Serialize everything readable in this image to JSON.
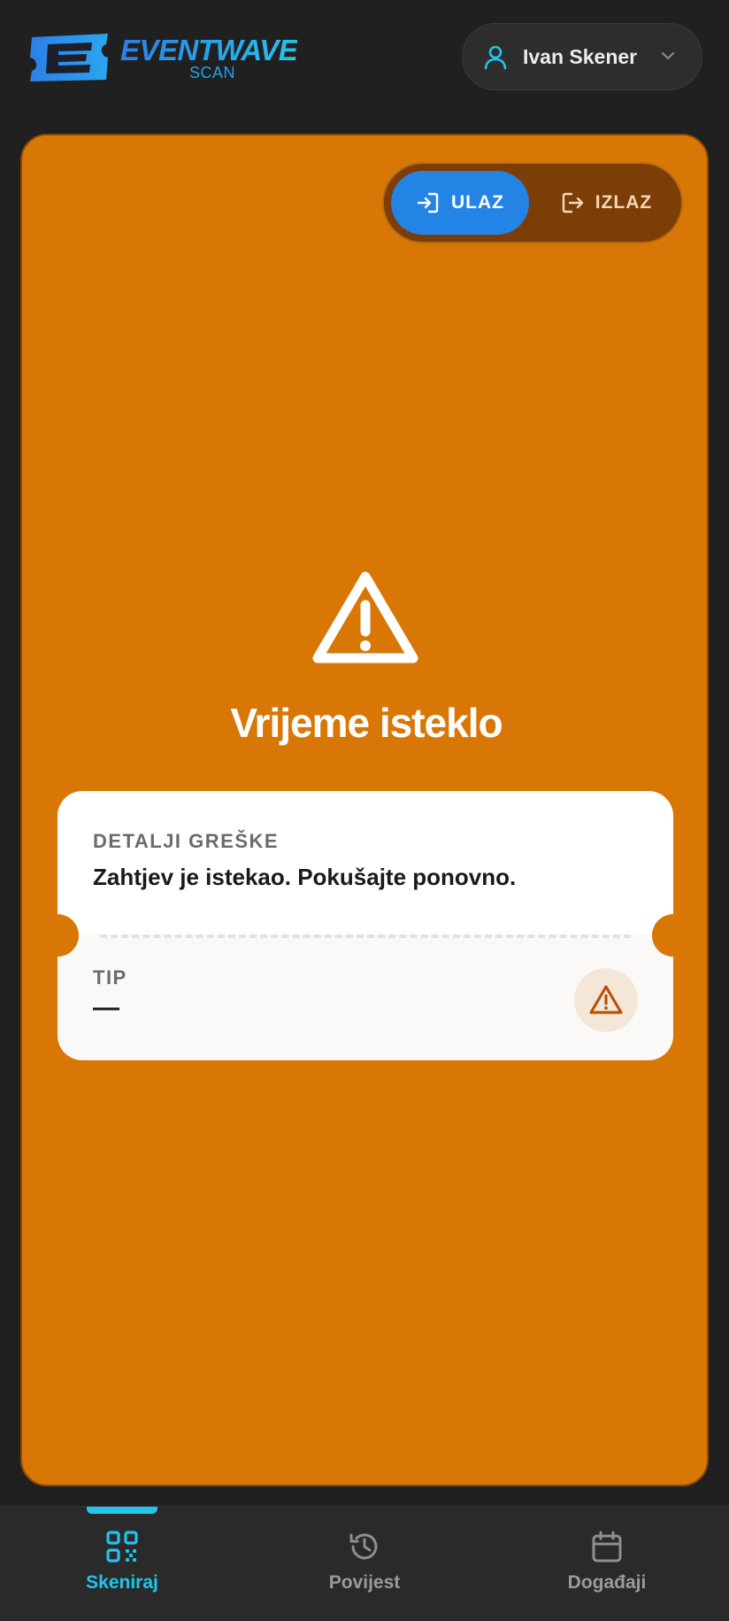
{
  "brand": {
    "name": "EVENTWAVE",
    "subtitle": "SCAN",
    "logo_icon": "ticket-e-logo-icon",
    "colors": {
      "primary": "#2484e6",
      "accent": "#22c4ee"
    }
  },
  "user": {
    "name": "Ivan Skener",
    "icon": "user-icon",
    "menu_icon": "chevron-down-icon"
  },
  "scan_mode": {
    "options": [
      {
        "label": "ULAZ",
        "icon": "sign-in-icon",
        "selected": true
      },
      {
        "label": "IZLAZ",
        "icon": "sign-out-icon",
        "selected": false
      }
    ]
  },
  "result": {
    "status_icon": "warning-triangle-icon",
    "title": "Vrijeme isteklo",
    "background_color": "#d97706",
    "details_label": "DETALJI GREŠKE",
    "details_text": "Zahtjev je istekao. Pokušajte ponovno.",
    "tip_label": "TIP",
    "tip_value": "—",
    "tip_icon": "warning-triangle-icon"
  },
  "bottom_nav": {
    "items": [
      {
        "label": "Skeniraj",
        "icon": "qr-code-icon",
        "active": true
      },
      {
        "label": "Povijest",
        "icon": "history-icon",
        "active": false
      },
      {
        "label": "Događaji",
        "icon": "calendar-icon",
        "active": false
      }
    ]
  }
}
